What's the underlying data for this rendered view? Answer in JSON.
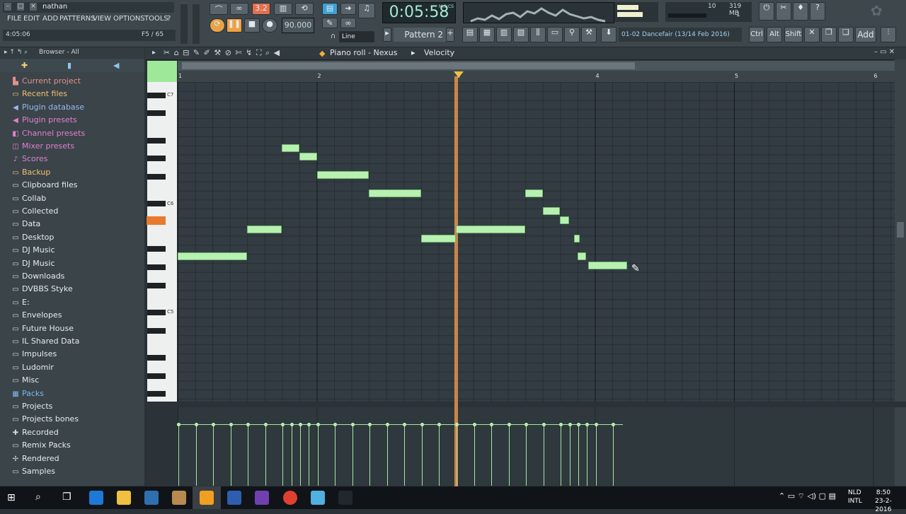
{
  "titlebar": {
    "user": "nathan"
  },
  "menu": [
    "FILE",
    "EDIT",
    "ADD",
    "PATTERNS",
    "VIEW",
    "OPTIONS",
    "TOOLS",
    "?"
  ],
  "hint": {
    "left": "4:05:06",
    "right": "F5 / 65"
  },
  "transport": {
    "time": "0:05:58",
    "time_sub": "M:S:CS",
    "tempo": "90.000",
    "pattern": "Pattern 2",
    "snap": "Line"
  },
  "cpu": {
    "value": "10",
    "mem": "319 MB",
    "poly": "1"
  },
  "song": {
    "title": "01-02  Dancefair (13/14 Feb 2016)"
  },
  "keys": {
    "ctrl": "Ctrl",
    "alt": "Alt",
    "shift": "Shift",
    "add": "Add"
  },
  "browser": {
    "header": "Browser - All",
    "items": [
      {
        "label": "Current project",
        "icon": "project-icon",
        "color": "#e58f8f"
      },
      {
        "label": "Recent files",
        "icon": "folder-icon",
        "color": "#f0c070"
      },
      {
        "label": "Plugin database",
        "icon": "plug-icon",
        "color": "#9ab8f0"
      },
      {
        "label": "Plugin presets",
        "icon": "plug-icon",
        "color": "#e080d0"
      },
      {
        "label": "Channel presets",
        "icon": "channel-icon",
        "color": "#e080d0"
      },
      {
        "label": "Mixer presets",
        "icon": "mixer-icon",
        "color": "#e080d0"
      },
      {
        "label": "Scores",
        "icon": "music-note-icon",
        "color": "#e080d0"
      },
      {
        "label": "Backup",
        "icon": "folder-icon",
        "color": "#f0c070"
      },
      {
        "label": "Clipboard files",
        "icon": "folder-icon",
        "color": "#d0d8dc"
      },
      {
        "label": "Collab",
        "icon": "folder-icon",
        "color": "#d0d8dc"
      },
      {
        "label": "Collected",
        "icon": "folder-icon",
        "color": "#d0d8dc"
      },
      {
        "label": "Data",
        "icon": "folder-icon",
        "color": "#d0d8dc"
      },
      {
        "label": "Desktop",
        "icon": "folder-icon",
        "color": "#d0d8dc"
      },
      {
        "label": "DJ Music",
        "icon": "folder-icon",
        "color": "#d0d8dc"
      },
      {
        "label": "DJ Music",
        "icon": "folder-icon",
        "color": "#d0d8dc"
      },
      {
        "label": "Downloads",
        "icon": "folder-icon",
        "color": "#d0d8dc"
      },
      {
        "label": "DVBBS Styke",
        "icon": "folder-icon",
        "color": "#d0d8dc"
      },
      {
        "label": "E:",
        "icon": "folder-icon",
        "color": "#d0d8dc"
      },
      {
        "label": "Envelopes",
        "icon": "folder-icon",
        "color": "#d0d8dc"
      },
      {
        "label": "Future House",
        "icon": "folder-icon",
        "color": "#d0d8dc"
      },
      {
        "label": "IL Shared Data",
        "icon": "folder-icon",
        "color": "#d0d8dc"
      },
      {
        "label": "Impulses",
        "icon": "folder-icon",
        "color": "#d0d8dc"
      },
      {
        "label": "Ludomir",
        "icon": "folder-icon",
        "color": "#d0d8dc"
      },
      {
        "label": "Misc",
        "icon": "folder-icon",
        "color": "#d0d8dc"
      },
      {
        "label": "Packs",
        "icon": "packs-icon",
        "color": "#80b8f0"
      },
      {
        "label": "Projects",
        "icon": "folder-icon",
        "color": "#d0d8dc"
      },
      {
        "label": "Projects bones",
        "icon": "folder-icon",
        "color": "#d0d8dc"
      },
      {
        "label": "Recorded",
        "icon": "recorded-icon",
        "color": "#d0d8dc"
      },
      {
        "label": "Remix Packs",
        "icon": "folder-icon",
        "color": "#d0d8dc"
      },
      {
        "label": "Rendered",
        "icon": "rendered-icon",
        "color": "#d0d8dc"
      },
      {
        "label": "Samples",
        "icon": "folder-icon",
        "color": "#d0d8dc"
      }
    ]
  },
  "pianoroll": {
    "title": "Piano roll - Nexus",
    "target": "Velocity",
    "bars": [
      "1",
      "2",
      "3",
      "4",
      "5",
      "6"
    ],
    "octave_labels": [
      "C7",
      "C6",
      "C5"
    ],
    "playhead_bar": 3.0,
    "notes": [
      {
        "start": 1.0,
        "len": 0.5,
        "row": 19
      },
      {
        "start": 1.5,
        "len": 0.25,
        "row": 16
      },
      {
        "start": 1.75,
        "len": 0.125,
        "row": 7
      },
      {
        "start": 1.875,
        "len": 0.125,
        "row": 8
      },
      {
        "start": 2.0,
        "len": 0.375,
        "row": 10
      },
      {
        "start": 2.375,
        "len": 0.375,
        "row": 12
      },
      {
        "start": 2.75,
        "len": 0.25,
        "row": 17
      },
      {
        "start": 3.0,
        "len": 0.5,
        "row": 16
      },
      {
        "start": 3.5,
        "len": 0.125,
        "row": 12
      },
      {
        "start": 3.625,
        "len": 0.125,
        "row": 14
      },
      {
        "start": 3.75,
        "len": 0.0625,
        "row": 15
      },
      {
        "start": 3.85,
        "len": 0.03,
        "row": 17
      },
      {
        "start": 3.875,
        "len": 0.0625,
        "row": 19
      },
      {
        "start": 3.95,
        "len": 0.28,
        "row": 20
      }
    ],
    "velocity_positions": [
      1.0,
      1.125,
      1.25,
      1.375,
      1.5,
      1.625,
      1.75,
      1.8125,
      1.875,
      1.9375,
      2.0,
      2.125,
      2.25,
      2.375,
      2.5,
      2.625,
      2.75,
      2.875,
      3.0,
      3.125,
      3.25,
      3.375,
      3.5,
      3.625,
      3.75,
      3.8125,
      3.875,
      3.9375,
      4.0,
      4.125
    ]
  },
  "taskbar": {
    "lang1": "NLD",
    "lang2": "INTL",
    "time": "8:50",
    "date": "23-2-2016"
  }
}
